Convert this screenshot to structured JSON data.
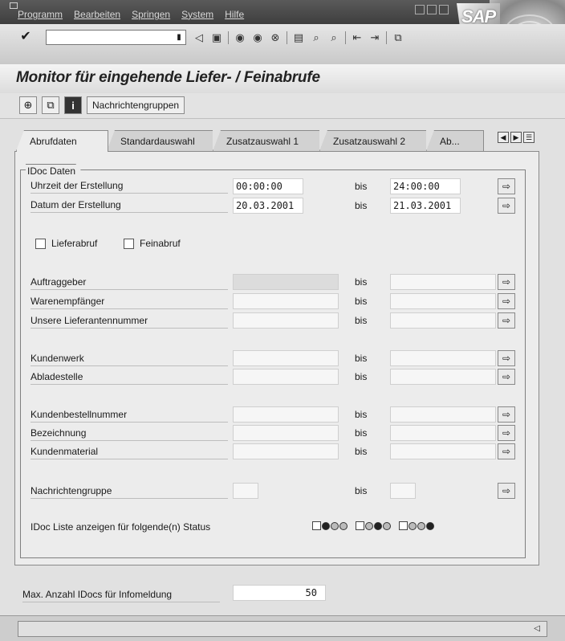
{
  "menu": {
    "items": [
      "Programm",
      "Bearbeiten",
      "Springen",
      "System",
      "Hilfe"
    ]
  },
  "brand": {
    "logo_text": "SAP"
  },
  "toolbar": {
    "command_value": "",
    "icons": [
      "back-icon",
      "save-icon",
      "nav-back-icon",
      "exit-icon",
      "cancel-icon",
      "print-icon",
      "find-icon",
      "find-next-icon",
      "first-page-icon",
      "last-page-icon",
      "new-session-icon"
    ]
  },
  "title": "Monitor für eingehende Liefer- / Feinabrufe",
  "app_toolbar": {
    "message_groups_button": "Nachrichtengruppen",
    "icons": [
      "execute-icon",
      "copy-variant-icon",
      "info-icon"
    ]
  },
  "tabs": [
    "Abrufdaten",
    "Standardauswahl",
    "Zusatzauswahl 1",
    "Zusatzauswahl 2",
    "Ab..."
  ],
  "active_tab": 0,
  "group": {
    "title": "IDoc Daten",
    "bis_label": "bis",
    "time_created": {
      "label": "Uhrzeit der Erstellung",
      "from": "00:00:00",
      "to": "24:00:00"
    },
    "date_created": {
      "label": "Datum der Erstellung",
      "from": "20.03.2001",
      "to": "21.03.2001"
    },
    "checkbox_delivery": {
      "label": "Lieferabruf",
      "checked": false
    },
    "checkbox_jit": {
      "label": "Feinabruf",
      "checked": false
    },
    "rows": [
      {
        "label": "Auftraggeber",
        "from": "",
        "to": ""
      },
      {
        "label": "Warenempfänger",
        "from": "",
        "to": ""
      },
      {
        "label": "Unsere Lieferantennummer",
        "from": "",
        "to": ""
      },
      {
        "label": "Kundenwerk",
        "from": "",
        "to": ""
      },
      {
        "label": "Abladestelle",
        "from": "",
        "to": ""
      },
      {
        "label": "Kundenbestellnummer",
        "from": "",
        "to": ""
      },
      {
        "label": "Bezeichnung",
        "from": "",
        "to": ""
      },
      {
        "label": "Kundenmaterial",
        "from": "",
        "to": ""
      }
    ],
    "message_group": {
      "label": "Nachrichtengruppe",
      "from": "",
      "to": ""
    },
    "status_label": "IDoc Liste anzeigen für folgende(n) Status"
  },
  "max_idocs": {
    "label": "Max. Anzahl IDocs für Infomeldung",
    "value": "50"
  },
  "status_bar": {
    "text": ""
  }
}
